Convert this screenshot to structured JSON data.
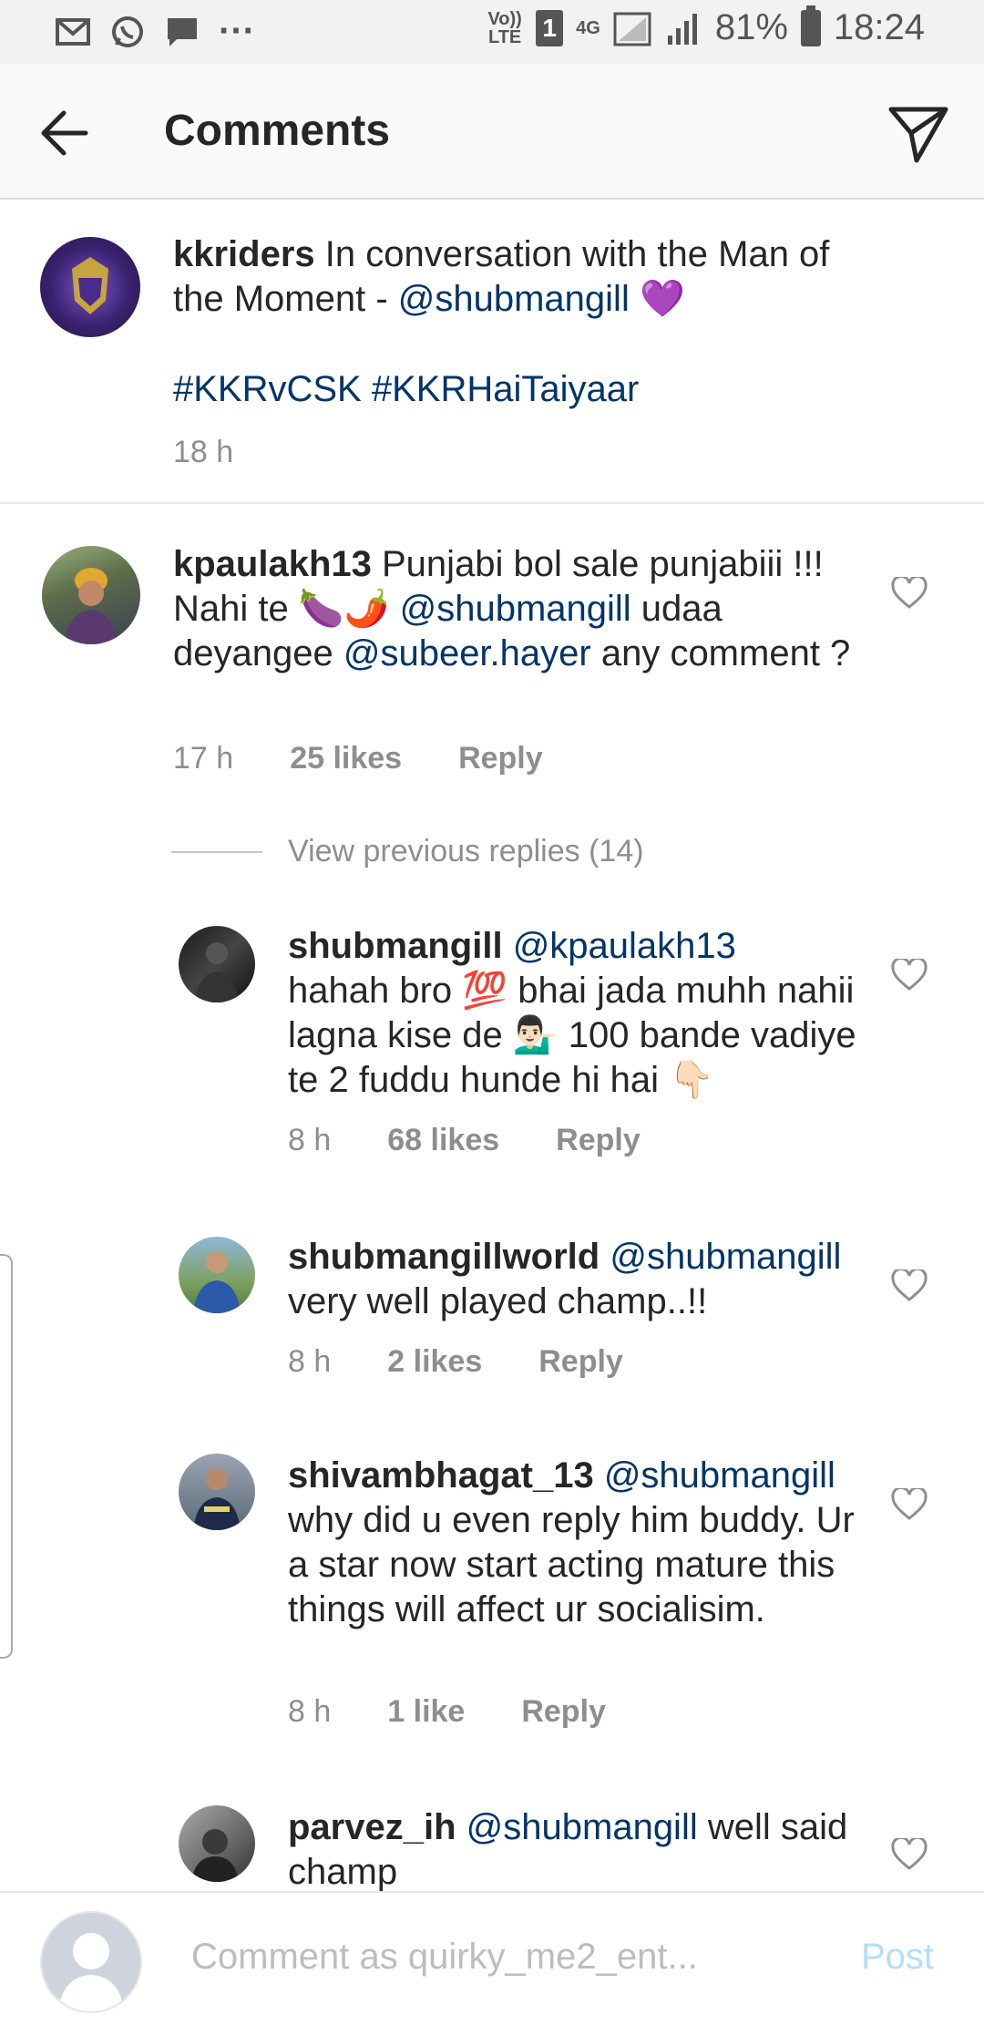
{
  "status_bar": {
    "left_icons": [
      "gmail-icon",
      "whatsapp-icon",
      "message-icon",
      "more-dots-icon"
    ],
    "dots": "···",
    "volte": "Vo)) LTE",
    "sim": "1",
    "network": "4G",
    "battery": "81%",
    "time": "18:24"
  },
  "header": {
    "title": "Comments"
  },
  "caption": {
    "username": "kkriders",
    "text1": " In conversation with the Man of the Moment - ",
    "mention": "@shubmangill",
    "emoji": "💜",
    "hashtags": "#KKRvCSK #KKRHaiTaiyaar",
    "time": "18 h"
  },
  "comments": [
    {
      "username": "kpaulakh13",
      "t1": " Punjabi bol sale punjabiii !!! Nahi te ",
      "emoji1": "🍆🌶️",
      "t2": " ",
      "m1": "@shubmangill",
      "t3": " udaa deyangee ",
      "m2": "@subeer.hayer",
      "t4": " any comment ?",
      "time": "17 h",
      "likes": "25 likes",
      "reply": "Reply"
    },
    {
      "username": "shubmangill",
      "m1": "@kpaulakh13",
      "t1": "hahah bro ",
      "e1": "💯",
      "t2": " bhai jada muhh nahii lagna kise de ",
      "e2": "💁🏻‍♂️",
      "t3": " 100 bande vadiye te 2 fuddu hunde hi hai ",
      "e3": "👇🏻",
      "time": "8 h",
      "likes": "68 likes",
      "reply": "Reply"
    },
    {
      "username": "shubmangillworld",
      "m1": "@shubmangill",
      "t1": " very well played champ..!!",
      "time": "8 h",
      "likes": "2 likes",
      "reply": "Reply"
    },
    {
      "username": "shivambhagat_13",
      "m1": "@shubmangill",
      "t1": " why did u even reply him buddy. Ur a star now start acting mature this things will affect ur socialisim.",
      "time": "8 h",
      "likes": "1 like",
      "reply": "Reply"
    },
    {
      "username": "parvez_ih",
      "m1": "@shubmangill",
      "t1": " well said champ"
    }
  ],
  "view_previous": "View previous replies (14)",
  "composer": {
    "placeholder": "Comment as quirky_me2_ent...",
    "post": "Post"
  },
  "colors": {
    "mention": "#003569",
    "muted": "#8e8e8e",
    "post_disabled": "#b2dffc"
  }
}
